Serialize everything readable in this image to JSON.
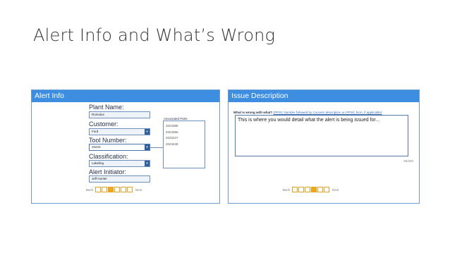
{
  "slide": {
    "title": "Alert Info and What’s Wrong"
  },
  "left_panel": {
    "header": "Alert Info",
    "plant_name": {
      "label": "Plant Name:",
      "value": "Romulus"
    },
    "customer": {
      "label": "Customer:",
      "value": "Ford"
    },
    "tool_number": {
      "label": "Tool Number:",
      "value": "10223"
    },
    "classification": {
      "label": "Classification:",
      "value": "Labeling"
    },
    "alert_initiator": {
      "label": "Alert Initiator:",
      "value": "Jeff Hunter"
    },
    "associated_parts": {
      "title": "Associated Parts",
      "items": [
        "2023395",
        "2023396",
        "2023437",
        "2023438"
      ]
    },
    "nav": {
      "back": "Back",
      "next": "Next",
      "steps_total": 6,
      "active_step": 3
    }
  },
  "right_panel": {
    "header": "Issue Description",
    "question": "What is wrong with what?",
    "hint": "(PPSC Number followed by Concern description on PPSC form, if applicable)",
    "text": "This is where you would detail what the alert is being issued for...",
    "counter": "68/250",
    "nav": {
      "back": "Back",
      "next": "Next",
      "steps_total": 6,
      "active_step": 4
    }
  },
  "colors": {
    "header_blue": "#3d8ee0",
    "step_accent": "#f0a818"
  },
  "icons": {
    "dropdown": "chevron-down-icon"
  }
}
